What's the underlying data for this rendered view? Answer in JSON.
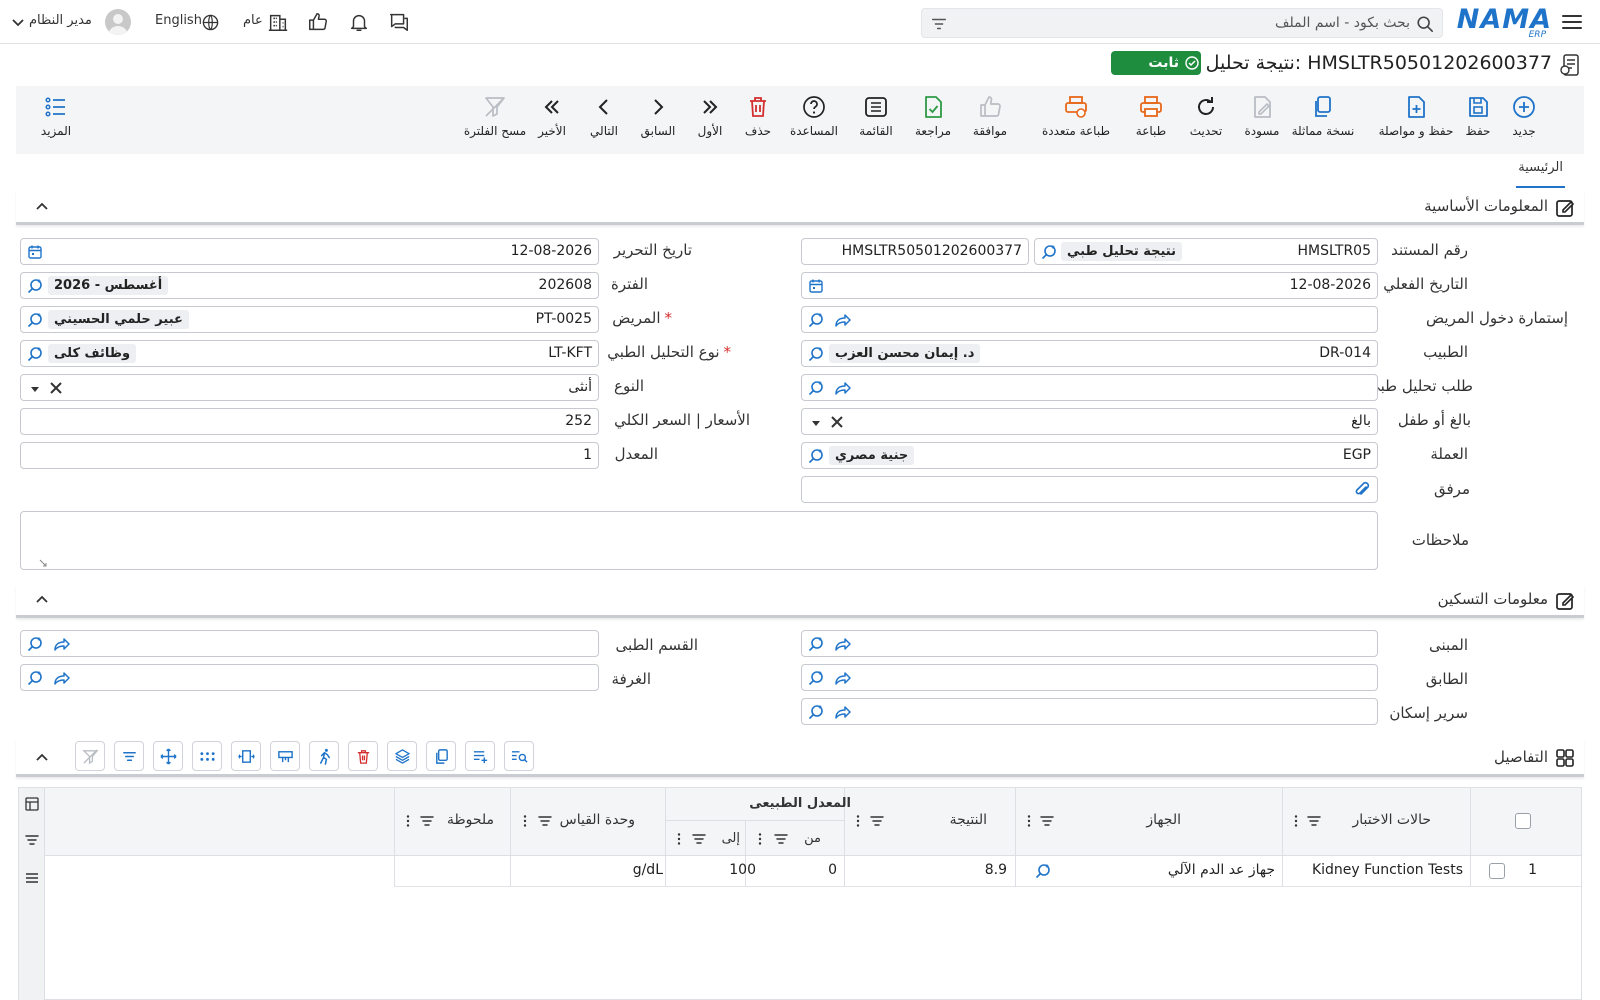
{
  "topbar": {
    "logo_text": "NAMA",
    "logo_sub": "ERP",
    "search_placeholder": "بحث بكود - اسم الملف",
    "branch_label": "عام",
    "language_label": "English",
    "user_label": "مدير النظام"
  },
  "page": {
    "title": "نتيجة تحليل طبي: HMSLTR50501202600377",
    "status": "ثابت"
  },
  "toolbar": {
    "new": "جديد",
    "save": "حفظ",
    "save_continue": "حفظ و مواصلة",
    "duplicate": "نسخة مماثلة",
    "draft": "مسودة",
    "refresh": "تحديث",
    "print": "طباعة",
    "multi_print": "طباعة متعددة",
    "approve": "موافقة",
    "review": "مراجعة",
    "list": "القائمة",
    "help": "المساعدة",
    "delete": "حذف",
    "first": "الأول",
    "previous": "السابق",
    "next": "التالي",
    "last": "الأخير",
    "clear_filter": "مسح الفلترة",
    "more": "المزيد"
  },
  "tabs": {
    "main": "الرئيسية"
  },
  "basic_info": {
    "title": "المعلومات الأساسية",
    "fields": {
      "doc_no_label": "رقم المستند",
      "doc_book_code": "HMSLTR05",
      "doc_book_name": "نتيجة تحليل طبي",
      "doc_no_value": "HMSLTR50501202600377",
      "edit_date_label": "تاريخ التحرير",
      "edit_date_value": "12-08-2026",
      "actual_date_label": "التاريخ الفعلي",
      "actual_date_value": "12-08-2026",
      "period_label": "الفترة",
      "period_code": "202608",
      "period_name": "2026 - أغسطس",
      "admission_label": "إستمارة دخول المريض",
      "patient_label": "المريض",
      "patient_code": "PT-0025",
      "patient_name": "عبير حلمي الحسيني",
      "doctor_label": "الطبيب",
      "doctor_code": "DR-014",
      "doctor_name": "د. إيمان محسن العزب",
      "analysis_type_label": "نوع التحليل الطبي",
      "analysis_type_code": "LT-KFT",
      "analysis_type_name": "وظائف كلى",
      "lab_request_label": "طلب تحليل طبى",
      "gender_label": "النوع",
      "gender_value": "أنثى",
      "age_group_label": "بالغ أو طفل",
      "age_group_value": "بالغ",
      "price_label": "الأسعار | السعر الكلي",
      "price_value": "252",
      "currency_label": "العملة",
      "currency_code": "EGP",
      "currency_name": "جنية مصري",
      "rate_label": "المعدل",
      "rate_value": "1",
      "attachment_label": "مرفق",
      "notes_label": "ملاحظات"
    }
  },
  "housing": {
    "title": "معلومات التسكين",
    "building_label": "المبنى",
    "department_label": "القسم الطبى",
    "floor_label": "الطابق",
    "room_label": "الغرفة",
    "bed_label": "سرير إسكان"
  },
  "details": {
    "title": "التفاصيل",
    "columns": {
      "test_cases": "حالات الاختبار",
      "device": "الجهاز",
      "result": "النتيجة",
      "normal_range": "المعدل الطبيعى",
      "from": "من",
      "to": "إلى",
      "unit": "وحدة القياس",
      "note": "ملحوظة"
    },
    "rows": [
      {
        "index": "1",
        "test_case": "Kidney Function Tests",
        "device": "جهاز عد الدم الآلي",
        "result": "8.9",
        "from": "0",
        "to": "100",
        "unit": "g/dL",
        "note": ""
      }
    ]
  },
  "colors": {
    "accent": "#1f74c9",
    "success": "#1e8e3e",
    "danger": "#d32f2f",
    "print": "#e8681a",
    "review": "#2e9a47",
    "disabled": "#b9bdc4"
  }
}
